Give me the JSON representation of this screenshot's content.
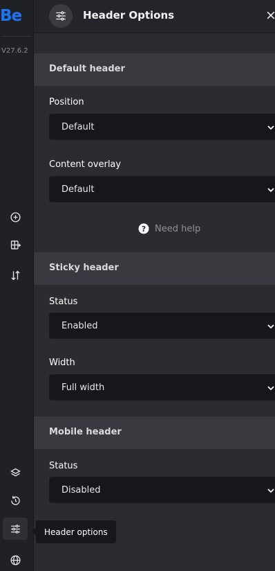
{
  "app": {
    "logo": "Be",
    "version": "V27.6.2"
  },
  "panel": {
    "title": "Header Options",
    "close": "×"
  },
  "sections": [
    {
      "title": "Default header",
      "fields": [
        {
          "label": "Position",
          "value": "Default"
        },
        {
          "label": "Content overlay",
          "value": "Default"
        }
      ],
      "help": "Need help"
    },
    {
      "title": "Sticky header",
      "fields": [
        {
          "label": "Status",
          "value": "Enabled"
        },
        {
          "label": "Width",
          "value": "Full width"
        }
      ]
    },
    {
      "title": "Mobile header",
      "fields": [
        {
          "label": "Status",
          "value": "Disabled"
        }
      ]
    }
  ],
  "rail": {
    "icons": [
      "add-circle-icon",
      "add-section-icon",
      "sort-icon",
      "layers-icon",
      "history-icon",
      "header-options-icon",
      "globe-icon"
    ],
    "tooltip": "Header options"
  },
  "colors": {
    "accent": "#1d74f5",
    "panel_bg": "#2b2c30",
    "section_bg": "#383a3f",
    "select_bg": "#16171a"
  }
}
